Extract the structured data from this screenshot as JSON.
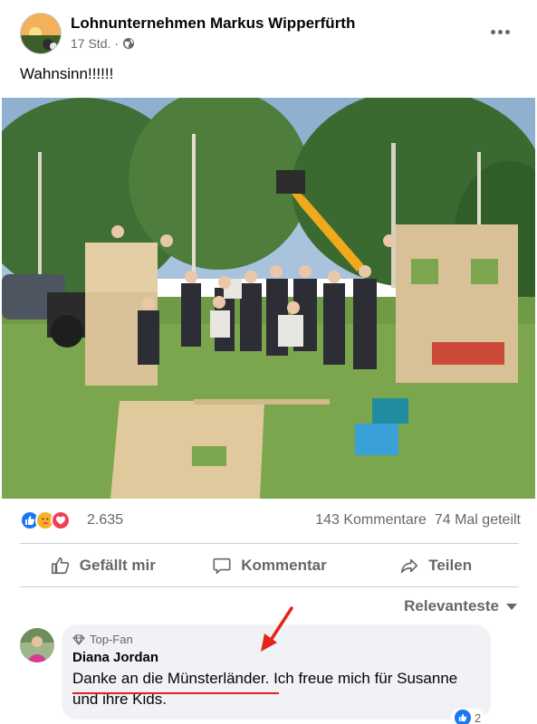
{
  "post": {
    "page_name": "Lohnunternehmen Markus Wipperfürth",
    "time": "17 Std.",
    "separator": "·",
    "privacy_icon": "globe-icon",
    "more_icon": "more-dots-icon",
    "text": "Wahnsinn!!!!!!"
  },
  "reactions": {
    "icons": [
      "like-icon",
      "care-icon",
      "love-icon"
    ],
    "count": "2.635",
    "comments_shares": "143 Kommentare  74 Mal geteilt"
  },
  "actions": {
    "like_label": "Gefällt mir",
    "comment_label": "Kommentar",
    "share_label": "Teilen"
  },
  "comments": {
    "sort_label": "Relevanteste",
    "first": {
      "badge": "Top-Fan",
      "author": "Diana Jordan",
      "text_part1": "Danke an die Münsterländer",
      "text_part2": ". Ich freue mich für Susanne und ihre Kids.",
      "likes": "2"
    }
  },
  "colors": {
    "facebook_blue": "#1877f2",
    "annotation_red": "#e4241b",
    "muted_text": "#65676b",
    "bubble_bg": "#f0f2f5"
  }
}
